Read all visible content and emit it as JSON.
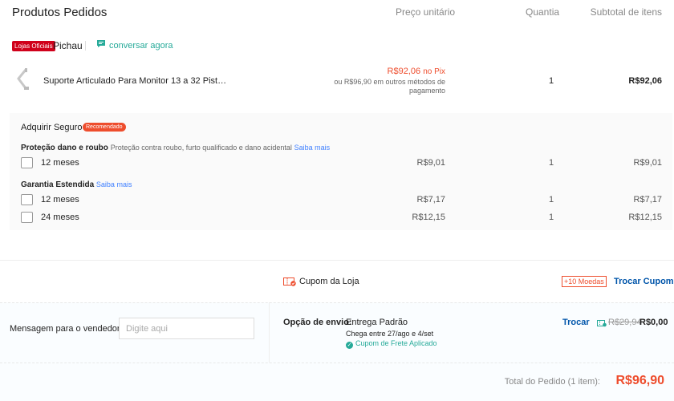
{
  "header": {
    "title": "Produtos Pedidos",
    "col_unit_price": "Preço unitário",
    "col_qty": "Quantia",
    "col_subtotal": "Subtotal de itens"
  },
  "shop": {
    "badge": "Lojas Oficiais",
    "name": "Pichau",
    "chat_label": "conversar agora"
  },
  "product": {
    "name": "Suporte Articulado Para Monitor 13 a 32 Pistão ...",
    "price_pix": "R$92,06",
    "pix_label": "no Pix",
    "price_other": "ou R$96,90 em outros métodos de pagamento",
    "qty": "1",
    "subtotal": "R$92,06"
  },
  "insurance": {
    "title": "Adquirir Seguro",
    "recommended": "Recomendado",
    "group1": {
      "name": "Proteção dano e roubo",
      "desc": "Proteção contra roubo, furto qualificado e dano acidental",
      "link": "Saiba mais",
      "options": [
        {
          "label": "12 meses",
          "price": "R$9,01",
          "qty": "1",
          "subtotal": "R$9,01"
        }
      ]
    },
    "group2": {
      "name": "Garantia Estendida",
      "link": "Saiba mais",
      "options": [
        {
          "label": "12 meses",
          "price": "R$7,17",
          "qty": "1",
          "subtotal": "R$7,17"
        },
        {
          "label": "24 meses",
          "price": "R$12,15",
          "qty": "1",
          "subtotal": "R$12,15"
        }
      ]
    }
  },
  "coupon": {
    "label": "Cupom da Loja",
    "coins": "+10 Moedas",
    "change": "Trocar Cupom"
  },
  "message": {
    "label": "Mensagem para o vendedor:",
    "placeholder": "Digite aqui",
    "value": ""
  },
  "shipping": {
    "label": "Opção de envio:",
    "method": "Entrega Padrão",
    "eta": "Chega entre 27/ago e 4/set",
    "free_coupon": "Cupom de Frete Aplicado",
    "change": "Trocar",
    "old_price": "R$29,94",
    "new_price": "R$0,00"
  },
  "total": {
    "label": "Total do Pedido (1 item):",
    "value": "R$96,90"
  },
  "colors": {
    "brand": "#ee4d2d",
    "teal": "#26aa99",
    "link_blue": "#05a",
    "official_badge": "#d0011b"
  }
}
